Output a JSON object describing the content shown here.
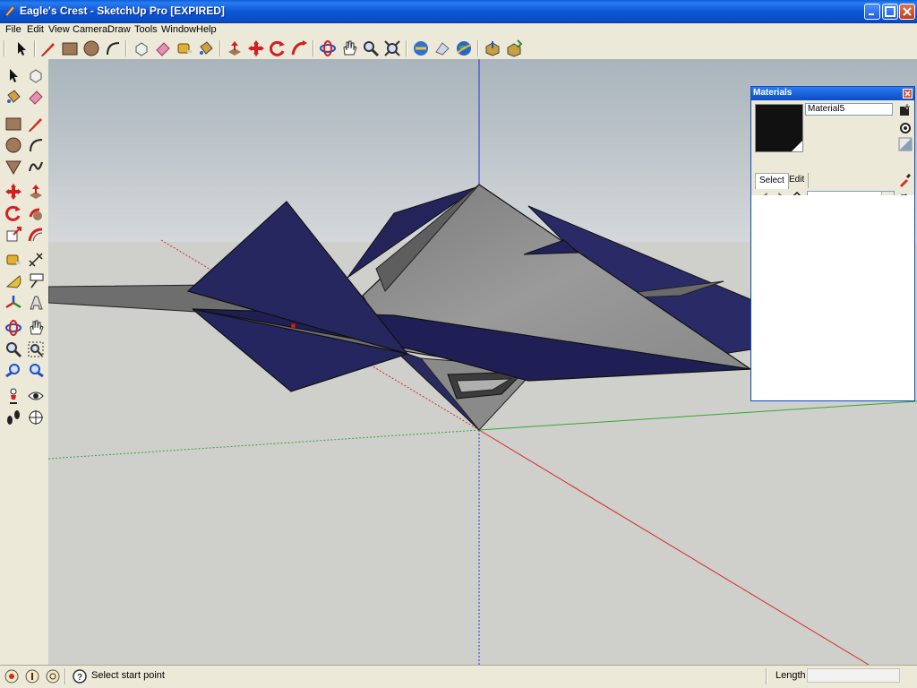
{
  "window": {
    "title": "Eagle's Crest - SketchUp Pro [EXPIRED]",
    "controls": [
      "minimize-icon",
      "maximize-icon",
      "close-icon"
    ]
  },
  "menubar": {
    "items": [
      "File",
      "Edit",
      "View",
      "Camera",
      "Draw",
      "Tools",
      "Window",
      "Help"
    ]
  },
  "toolbar": {
    "icons": [
      "select-arrow-icon",
      "line-pencil-icon",
      "rectangle-icon",
      "circle-icon",
      "arc-icon",
      "make-component-icon",
      "eraser-icon",
      "tape-measure-icon",
      "paint-bucket-icon",
      "push-pull-icon",
      "move-icon",
      "rotate-icon",
      "follow-me-icon",
      "orbit-icon",
      "pan-hand-icon",
      "zoom-icon",
      "zoom-extents-icon",
      "get-models-icon",
      "share-model-icon",
      "google-earth-icon",
      "get-component-icon",
      "share-component-icon"
    ]
  },
  "left_toolbar": {
    "icons": [
      "select-arrow-icon",
      "make-component-icon",
      "paint-bucket-icon",
      "eraser-icon",
      "rectangle-icon",
      "line-pencil-icon",
      "circle-icon",
      "arc-icon",
      "polygon-icon",
      "freehand-icon",
      "move-icon",
      "push-pull-icon",
      "rotate-icon",
      "follow-me-icon",
      "scale-icon",
      "offset-icon",
      "tape-measure-icon",
      "dimension-icon",
      "protractor-icon",
      "text-icon",
      "axes-icon",
      "3d-text-icon",
      "orbit-icon",
      "pan-hand-icon",
      "zoom-icon",
      "zoom-window-icon",
      "previous-view-icon",
      "next-view-icon",
      "position-camera-icon",
      "look-around-icon",
      "walk-icon",
      "section-plane-icon"
    ]
  },
  "status": {
    "text": "Select start point",
    "measure_label": "Length",
    "measure_value": ""
  },
  "materials_panel": {
    "title": "Materials",
    "material_name": "Material5",
    "tabs": [
      "Select",
      "Edit"
    ],
    "active_tab": "Select",
    "collection_value": ""
  },
  "colors": {
    "titlebar": "#0b56d6",
    "sky": "#b7c2ca",
    "ground": "#cfcfcb",
    "navy_panels": "#24245a",
    "concrete": "#8c8c8c",
    "axis_red": "#d22a2a",
    "axis_green": "#36a836",
    "axis_blue": "#2a2ad2"
  }
}
